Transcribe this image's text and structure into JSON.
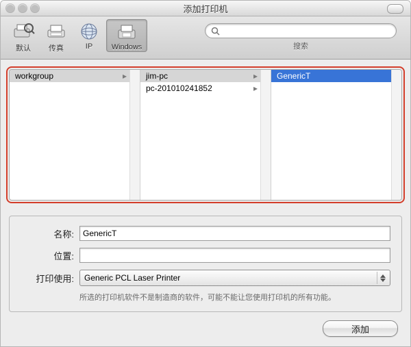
{
  "window": {
    "title": "添加打印机"
  },
  "toolbar": {
    "items": [
      {
        "label": "默认"
      },
      {
        "label": "传真"
      },
      {
        "label": "IP"
      },
      {
        "label": "Windows"
      }
    ],
    "search_label": "搜索",
    "search_value": ""
  },
  "browser": {
    "col1": [
      {
        "label": "workgroup",
        "selected": "gray",
        "has_children": true
      }
    ],
    "col2": [
      {
        "label": "jim-pc",
        "selected": "gray",
        "has_children": true
      },
      {
        "label": "pc-201010241852",
        "selected": "none",
        "has_children": true
      }
    ],
    "col3": [
      {
        "label": "GenericT",
        "selected": "blue",
        "has_children": false
      }
    ]
  },
  "form": {
    "name_label": "名称:",
    "name_value": "GenericT",
    "location_label": "位置:",
    "location_value": "",
    "driver_label": "打印使用:",
    "driver_value": "Generic PCL Laser Printer",
    "note": "所选的打印机软件不是制造商的软件，可能不能让您使用打印机的所有功能。"
  },
  "footer": {
    "add_label": "添加"
  }
}
